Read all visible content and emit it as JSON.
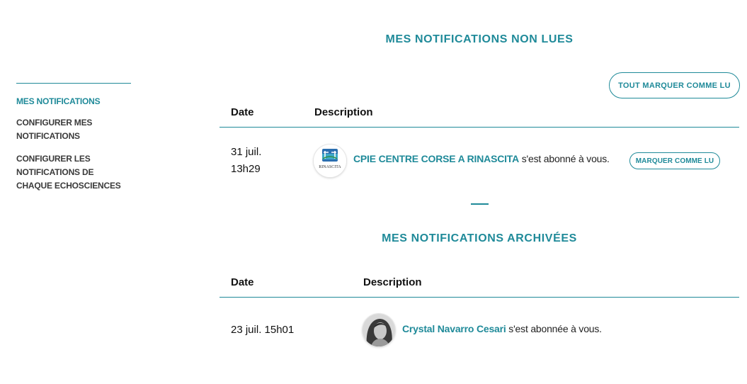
{
  "sidebar": {
    "items": [
      {
        "label": "MES NOTIFICATIONS"
      },
      {
        "label": "CONFIGURER MES NOTIFICATIONS"
      },
      {
        "label": "CONFIGURER LES NOTIFICATIONS DE CHAQUE ECHOSCIENCES"
      }
    ]
  },
  "unread": {
    "title": "MES NOTIFICATIONS NON LUES",
    "mark_all_label": "TOUT MARQUER COMME LU",
    "columns": {
      "date": "Date",
      "description": "Description"
    },
    "rows": [
      {
        "date_line1": "31 juil.",
        "date_line2": "13h29",
        "avatar_text": "RINASCITA",
        "actor": "CPIE CENTRE CORSE A RINASCITA",
        "action": "s'est abonné à vous.",
        "mark_label": "MARQUER COMME LU"
      }
    ]
  },
  "archived": {
    "title": "MES NOTIFICATIONS ARCHIVÉES",
    "columns": {
      "date": "Date",
      "description": "Description"
    },
    "rows": [
      {
        "date": "23 juil. 15h01",
        "actor": "Crystal Navarro Cesari",
        "action": "s'est abonnée à vous."
      }
    ]
  },
  "colors": {
    "accent": "#1f8a99"
  }
}
